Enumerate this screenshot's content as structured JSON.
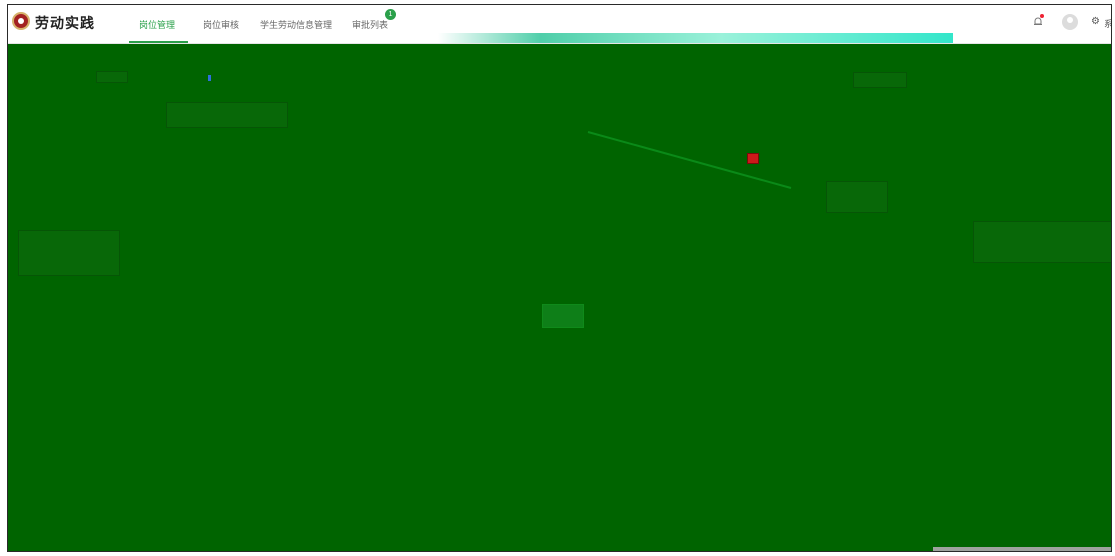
{
  "app": {
    "title": "劳动实践"
  },
  "nav": {
    "items": [
      {
        "label": "岗位管理",
        "active": true
      },
      {
        "label": "岗位审核",
        "active": false
      },
      {
        "label": "学生劳动信息管理",
        "active": false
      },
      {
        "label": "审批列表",
        "active": false
      }
    ],
    "approval_badge": "1"
  },
  "header_right": {
    "user_text_partial": "系"
  },
  "main": {
    "center_button_label": ""
  },
  "colors": {
    "content_bg": "#006400",
    "accent": "#2aa04a",
    "marker_red": "#cc1a1a"
  },
  "icons": [
    "logo",
    "bell-icon",
    "avatar",
    "gear-icon"
  ]
}
